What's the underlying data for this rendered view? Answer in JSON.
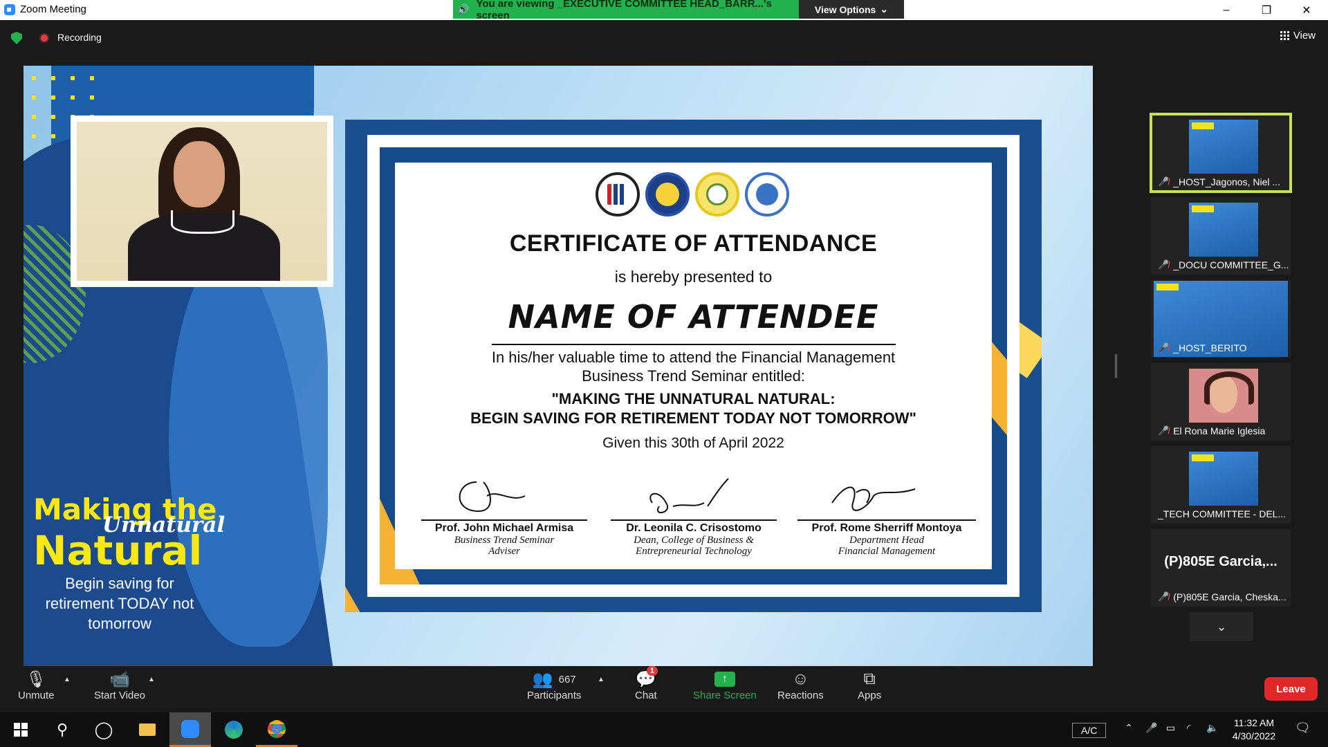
{
  "window": {
    "title": "Zoom Meeting",
    "viewing_banner": "You are viewing _EXECUTIVE COMMITTEE HEAD_BARR...'s screen",
    "view_options": "View Options",
    "minimize": "–",
    "maximize": "❐",
    "close": "✕"
  },
  "meeting_bar": {
    "recording_label": "Recording",
    "view_label": "View"
  },
  "slide": {
    "slogan_line1": "Making the",
    "slogan_line2": "Unnatural",
    "slogan_line3": "Natural",
    "slogan_line4": "Begin saving for retirement TODAY not tomorrow"
  },
  "certificate": {
    "title": "CERTIFICATE OF ATTENDANCE",
    "presented": "is hereby presented to",
    "name": "NAME OF ATTENDEE",
    "body_line1": "In his/her valuable time to attend the Financial Management",
    "body_line2": "Business Trend Seminar entitled:",
    "seminar_line1": "\"MAKING THE UNNATURAL NATURAL:",
    "seminar_line2": "BEGIN SAVING FOR RETIREMENT TODAY NOT TOMORROW\"",
    "date": "Given this 30th of April 2022",
    "signatories": [
      {
        "name": "Prof. John Michael Armisa",
        "role1": "Business Trend Seminar",
        "role2": "Adviser"
      },
      {
        "name": "Dr. Leonila C. Crisostomo",
        "role1": "Dean, College of Business &",
        "role2": "Entrepreneurial Technology"
      },
      {
        "name": "Prof. Rome Sherriff Montoya",
        "role1": "Department Head",
        "role2": "Financial Management"
      }
    ]
  },
  "gallery": {
    "tiles": [
      {
        "label": "_HOST_Jagonos, Niel ..."
      },
      {
        "label": "_DOCU COMMITTEE_G..."
      },
      {
        "label": "_HOST_BERITO"
      },
      {
        "label": "El Rona Marie Iglesia"
      },
      {
        "label": "_TECH COMMITTEE - DEL..."
      },
      {
        "big_name": "(P)805E Garcia,...",
        "label": "(P)805E Garcia, Cheska..."
      }
    ],
    "more_icon": "chevron-down-icon"
  },
  "toolbar": {
    "unmute": "Unmute",
    "start_video": "Start Video",
    "participants_count": "667",
    "participants": "Participants",
    "chat": "Chat",
    "chat_badge": "1",
    "share_screen": "Share Screen",
    "reactions": "Reactions",
    "apps": "Apps",
    "leave": "Leave",
    "accent_green": "#23b14d",
    "leave_red": "#e02828"
  },
  "taskbar": {
    "input_method": "A/C",
    "time": "11:32 AM",
    "date": "4/30/2022"
  }
}
